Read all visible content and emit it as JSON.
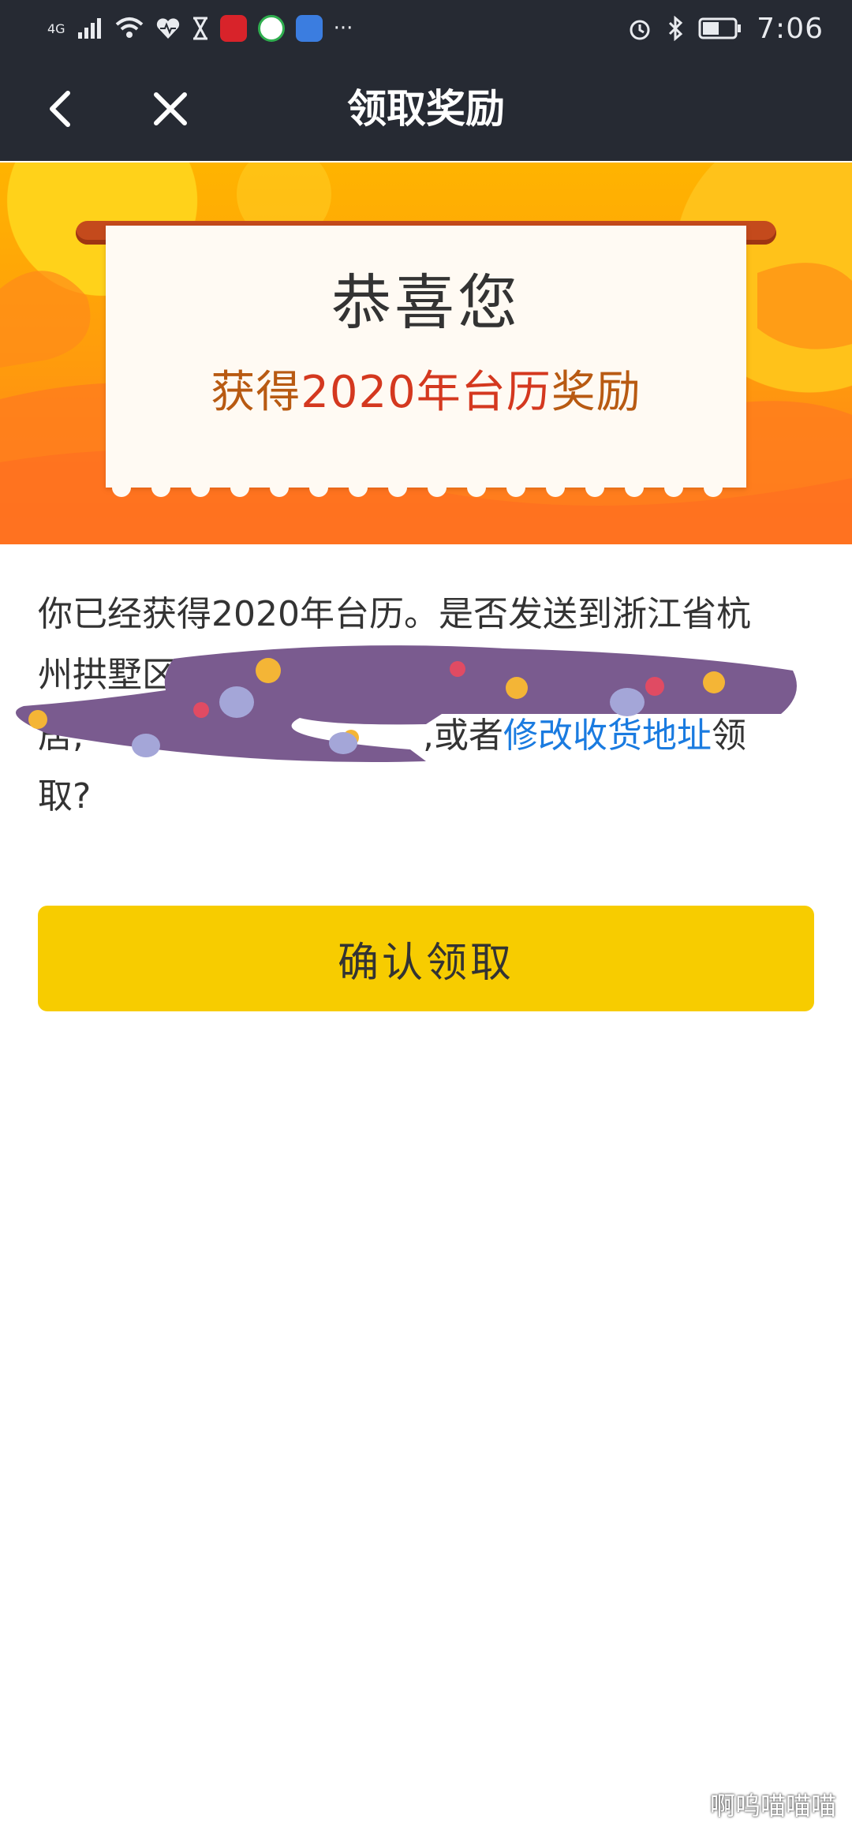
{
  "status_bar": {
    "network": "4G",
    "time": "7:06",
    "more": "···"
  },
  "nav": {
    "title": "领取奖励"
  },
  "banner": {
    "congrats": "恭喜您",
    "reward_prefix": "获得",
    "reward_highlight": "2020年台历",
    "reward_suffix": "奖励"
  },
  "message": {
    "line1": "你已经获得2020年台历。是否发送到浙江省杭",
    "line2_visible": "州拱墅区",
    "line3_prefix": "居,",
    "line3_or": ",或者",
    "link_text": "修改收货地址",
    "line3_end": "领",
    "line4": "取?"
  },
  "confirm_button": {
    "label": "确认领取"
  },
  "watermark": {
    "text": "啊呜喵喵喵"
  },
  "colors": {
    "dark_bar": "#262a33",
    "banner_orange": "#ff9a0d",
    "reward_red": "#d4381f",
    "link_blue": "#1a7be0",
    "button_yellow": "#f7cc00",
    "redaction_purple": "#7a5b8f"
  }
}
